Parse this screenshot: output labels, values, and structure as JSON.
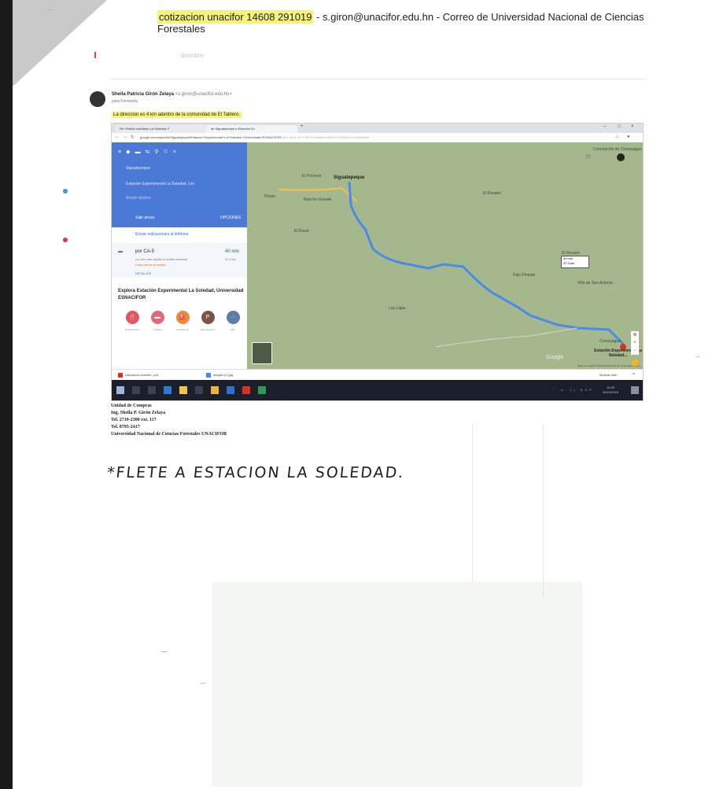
{
  "page_title": {
    "subject": "cotizacion unacifor 14608 291019",
    "rest": " - s.giron@unacifor.edu.hn - Correo de Universidad Nacional de Ciencias Forestales"
  },
  "faint_label": "diembre",
  "email": {
    "sender_name": "Sheila Patricia Girón Zelaya",
    "sender_email": "<s.giron@unacifor.edu.hn>",
    "recipient": "para Ferreteria",
    "body": "La direccion es 4 km adentro de la comunidad de El Tablero."
  },
  "browser": {
    "tabs": [
      "Re: Pedido solicitado La Soledad, F",
      "de Siguatepeque a Estación Ex"
    ],
    "new_tab_icon": "+",
    "window_controls": [
      "–",
      "□",
      "×"
    ],
    "url": "google.com/maps/dir/Siguatepeque/Estacion+Experimental+La+Soledad,+Universidad+ESNACIFOR",
    "url_tail": "/@14.5113,-87.6789,12z/data=!4m8!4m7!1m5!1m1!1s0x8f65a5"
  },
  "maps": {
    "origin": "Siguatepeque",
    "destination": "Estación Experimental La Soledad, Uni",
    "add_destination": "Añadir destino",
    "leave_now": "Salir ahora",
    "options": "OPCIONES",
    "send_to_phone": "Enviar indicaciones al teléfono",
    "route": {
      "via": "por CA-5",
      "time": "40 min",
      "distance": "37,3 km",
      "note": "La ruta más rápida en tráfico habitual",
      "warning": "Esta ruta tiene peajes",
      "details": "DETALLES"
    },
    "explore": "Explora Estación Experimental La Soledad, Universidad ESNACIFOR",
    "poi": [
      {
        "icon": "restaurant-icon",
        "glyph": "🍴",
        "color": "#e25563",
        "label": "Restaurantes"
      },
      {
        "icon": "hotel-icon",
        "glyph": "▬",
        "color": "#e06a7b",
        "label": "Hoteles"
      },
      {
        "icon": "gas-station-icon",
        "glyph": "⛽",
        "color": "#f0883e",
        "label": "Gasolineras"
      },
      {
        "icon": "parking-icon",
        "glyph": "P",
        "color": "#7b5547",
        "label": "Aparcamiento"
      },
      {
        "icon": "more-icon",
        "glyph": "···",
        "color": "#5d7ea8",
        "label": "Más"
      }
    ],
    "map_labels": {
      "siguatepeque": "Siguatepeque",
      "el_porvenir": "El Porvenir",
      "el_rosario": "El Rosario",
      "concepcion": "Concepción de Comayagua",
      "la_rosa": "El Rosal",
      "villa_de_san_antonio": "Villa de San Antonio",
      "el_rosario2": "El Rosario",
      "palo_pintado": "Palo Pintado",
      "comayagua": "Comayagua",
      "flores": "Flores",
      "las_lajas": "Las Lajas",
      "rancho": "Rancho Grande"
    },
    "route_box_time": "40 min",
    "route_box_dist": "37,3 km",
    "destination_label": "Estación Experimental La Soledad...",
    "google": "Google",
    "scale": "Datos de mapas ©2019  Términos  Enviar comentarios  1 km"
  },
  "downloads": {
    "items": [
      {
        "name": "cotizacion unacifor...pdf",
        "icon": "pdf-icon"
      },
      {
        "name": "images (1).jpg",
        "icon": "image-icon"
      }
    ],
    "show_all": "Mostrar todo",
    "close": "×"
  },
  "taskbar": {
    "clock_time": "10:30",
    "clock_date": "29/10/2019",
    "tray": "⌃ ▭ ◁) ESP"
  },
  "signature": [
    "Unidad de Compras",
    "Ing. Sheila P. Girón Zelaya",
    "Tel. 2710-2300 ext. 117",
    "Tel. 8795-2417",
    "Universidad Nacional de Ciencias Forestales UNACIFOR"
  ],
  "handwriting": "*FLETE A ESTACION LA SOLEDAD."
}
